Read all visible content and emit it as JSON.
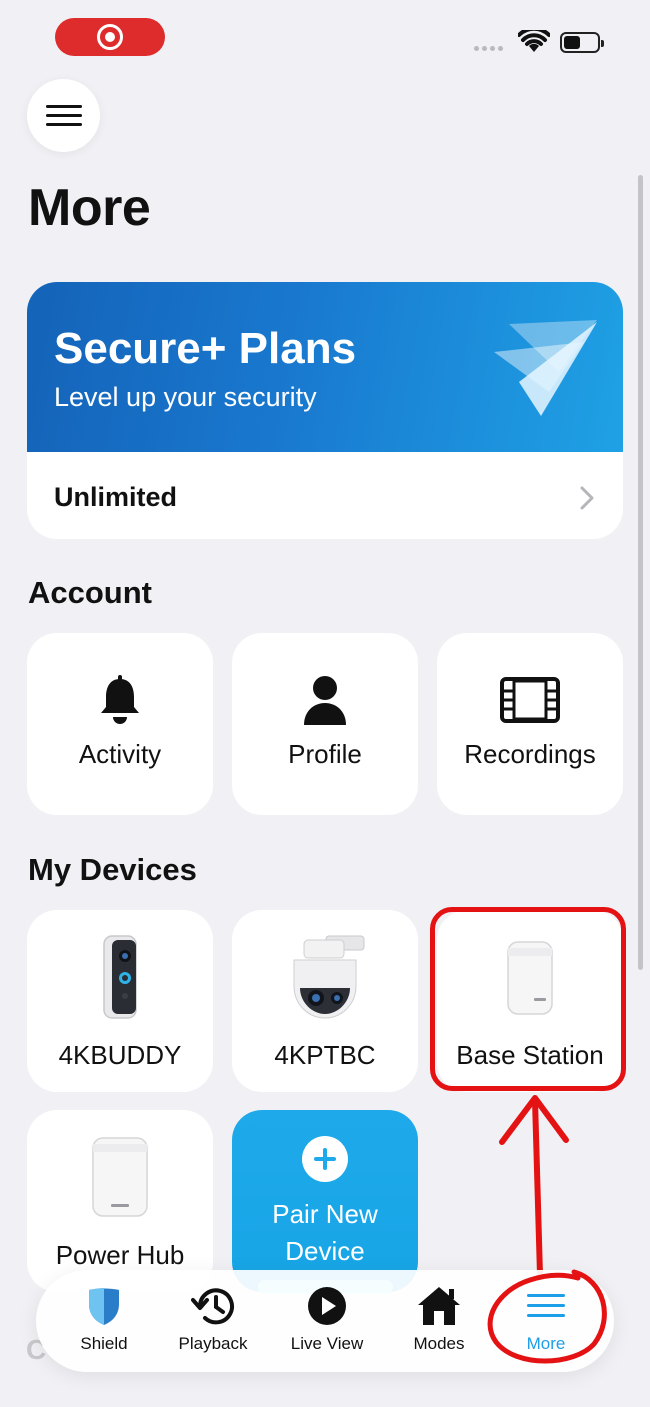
{
  "page": {
    "title": "More"
  },
  "plan": {
    "title": "Secure+ Plans",
    "subtitle": "Level up your security",
    "row_label": "Unlimited"
  },
  "account": {
    "title": "Account",
    "items": [
      {
        "label": "Activity",
        "icon": "bell-icon"
      },
      {
        "label": "Profile",
        "icon": "person-icon"
      },
      {
        "label": "Recordings",
        "icon": "film-icon"
      }
    ]
  },
  "devices": {
    "title": "My Devices",
    "items": [
      {
        "label": "4KBUDDY",
        "icon": "doorbell-icon"
      },
      {
        "label": "4KPTBC",
        "icon": "ptz-camera-icon"
      },
      {
        "label": "Base Station",
        "icon": "base-station-icon"
      },
      {
        "label": "Power Hub",
        "icon": "power-hub-icon"
      }
    ],
    "pair_label_line1": "Pair New",
    "pair_label_line2": "Device"
  },
  "tabbar": {
    "tabs": [
      {
        "label": "Shield",
        "icon": "shield-icon"
      },
      {
        "label": "Playback",
        "icon": "history-icon"
      },
      {
        "label": "Live View",
        "icon": "play-icon"
      },
      {
        "label": "Modes",
        "icon": "home-icon"
      },
      {
        "label": "More",
        "icon": "menu-icon",
        "active": true
      }
    ]
  },
  "colors": {
    "accent": "#1d9ee8",
    "annotation": "#e41212",
    "banner": "#1979cf"
  }
}
